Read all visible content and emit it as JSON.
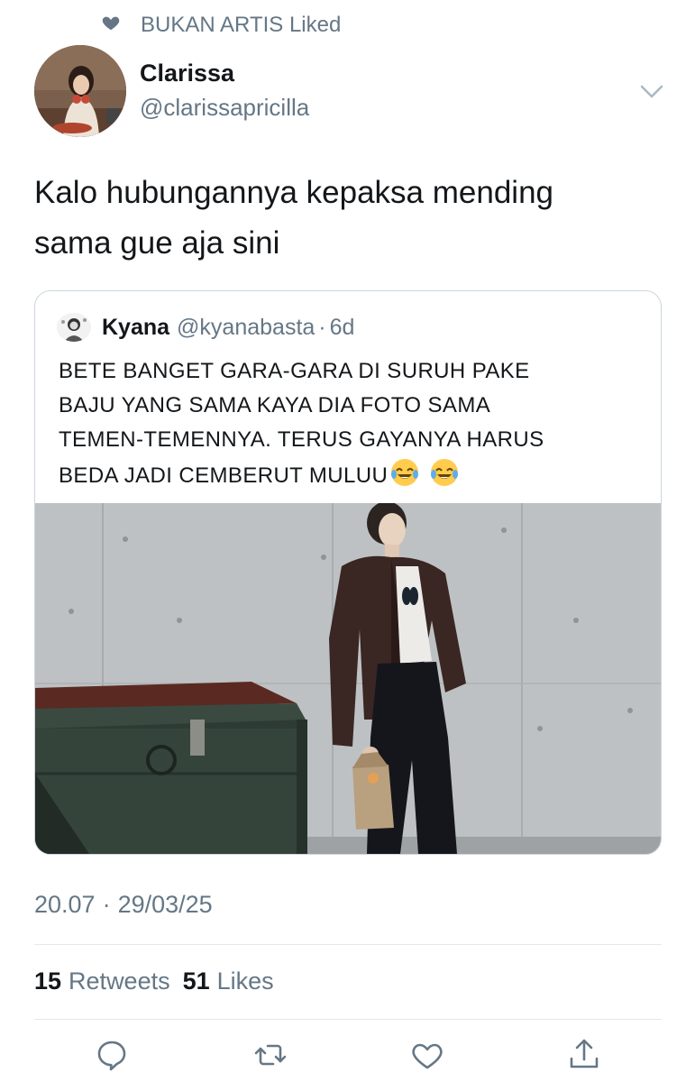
{
  "social_context": {
    "icon": "heart-icon",
    "text": "BUKAN ARTIS Liked"
  },
  "author": {
    "name": "Clarissa",
    "handle": "@clarissapricilla",
    "avatar": "avatar-photo"
  },
  "tweet": {
    "text_line1": "Kalo hubungannya kepaksa mending",
    "text_line2": "sama gue aja sini"
  },
  "quote": {
    "name": "Kyana",
    "handle": "@kyanabasta",
    "separator": "·",
    "time": "6d",
    "lines": [
      "BETE BANGET GARA-GARA DI SURUH PAKE",
      "BAJU YANG SAMA KAYA DIA FOTO SAMA",
      "TEMEN-TEMENNYA. TERUS GAYANYA HARUS",
      "BEDA JADI CEMBERUT MULUU"
    ],
    "emojis": [
      "face-with-tears-of-joy",
      "face-with-tears-of-joy"
    ],
    "image": "photo of person in leather jacket leaning on concrete wall beside dumpster"
  },
  "meta": {
    "time": "20.07",
    "separator": "·",
    "date": "29/03/25"
  },
  "stats": {
    "retweets_count": "15",
    "retweets_label": "Retweets",
    "likes_count": "51",
    "likes_label": "Likes"
  },
  "actions": [
    "reply-icon",
    "retweet-icon",
    "like-icon",
    "share-icon"
  ],
  "colors": {
    "text": "#14171a",
    "secondary": "#657786",
    "border": "#ccd6dd",
    "divider": "#e1e8ed"
  }
}
